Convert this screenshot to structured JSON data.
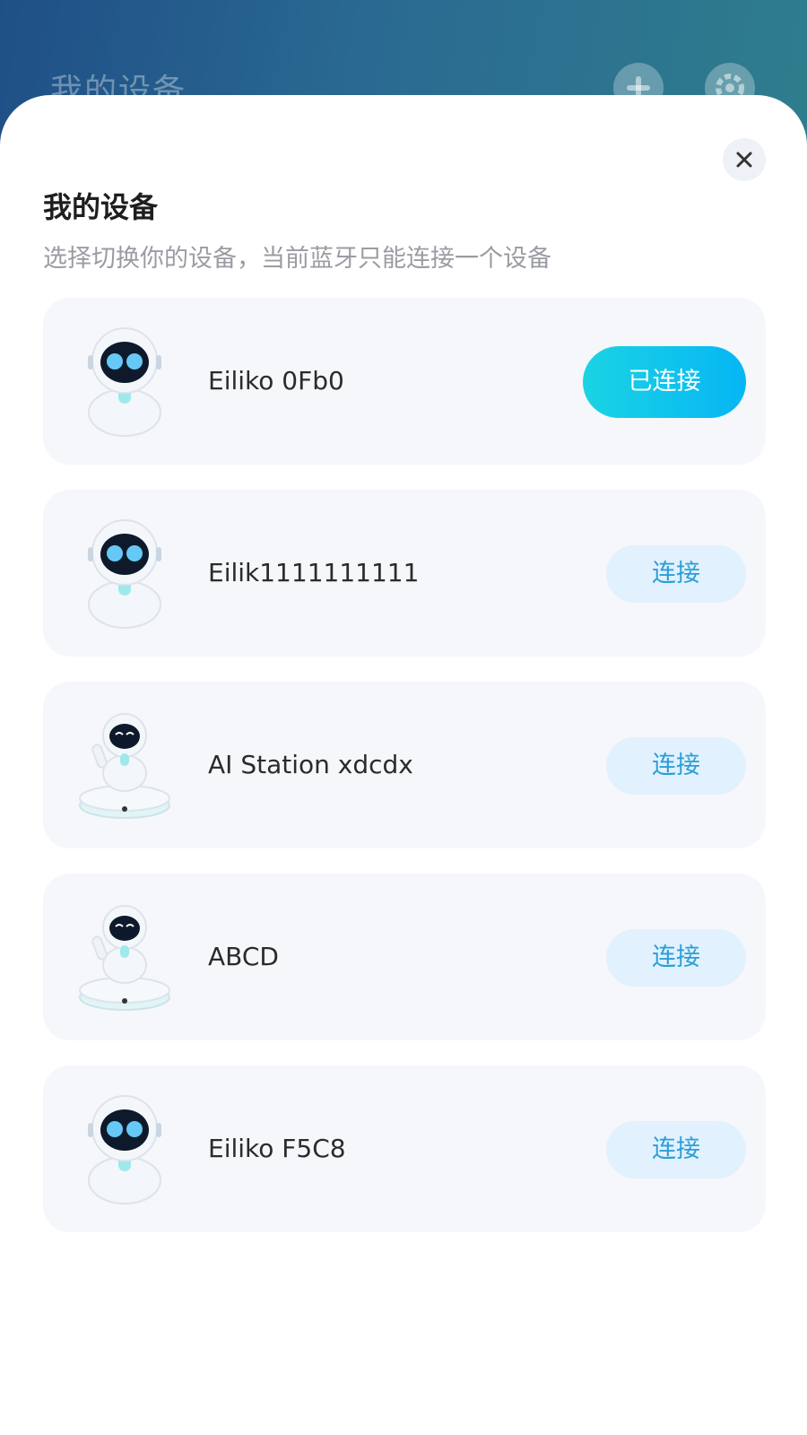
{
  "background": {
    "title": "我的设备",
    "add_icon": "plus-icon",
    "settings_icon": "gear-icon"
  },
  "sheet": {
    "title": "我的设备",
    "subtitle": "选择切换你的设备，当前蓝牙只能连接一个设备",
    "close_icon": "close-icon"
  },
  "devices": [
    {
      "name": "Eiliko 0Fb0",
      "button": "已连接",
      "status": "connected",
      "avatar": "robot-icon"
    },
    {
      "name": "Eilik1111111111",
      "button": "连接",
      "status": "disconnected",
      "avatar": "robot-icon"
    },
    {
      "name": "AI Station xdcdx",
      "button": "连接",
      "status": "disconnected",
      "avatar": "robot-station-icon"
    },
    {
      "name": "ABCD",
      "button": "连接",
      "status": "disconnected",
      "avatar": "robot-station-icon"
    },
    {
      "name": "Eiliko F5C8",
      "button": "连接",
      "status": "disconnected",
      "avatar": "robot-icon"
    }
  ],
  "colors": {
    "accent_start": "#1bd3e3",
    "accent_end": "#06b6f5",
    "connect_bg": "#e1f1fd",
    "connect_text": "#2a9ed8"
  }
}
